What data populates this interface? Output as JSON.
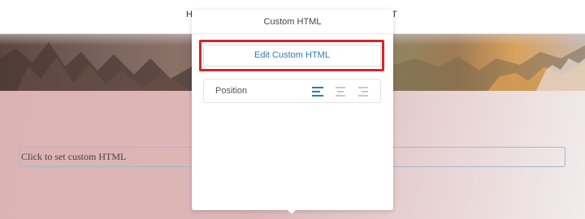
{
  "nav": {
    "left_text": "H",
    "right_text": "T"
  },
  "section": {
    "custom_html_placeholder": "Click to set custom HTML"
  },
  "popover": {
    "title": "Custom HTML",
    "edit_button_label": "Edit Custom HTML",
    "position_label": "Position",
    "alignment_options": [
      "left",
      "center",
      "right"
    ],
    "selected_alignment": "left"
  },
  "colors": {
    "accent": "#2b7bc0",
    "highlight_border": "#d3262b",
    "section_background": "#dcb3b3",
    "inactive_icon": "#c9c9c9"
  },
  "icons": [
    "align-left-icon",
    "align-center-icon",
    "align-right-icon"
  ]
}
